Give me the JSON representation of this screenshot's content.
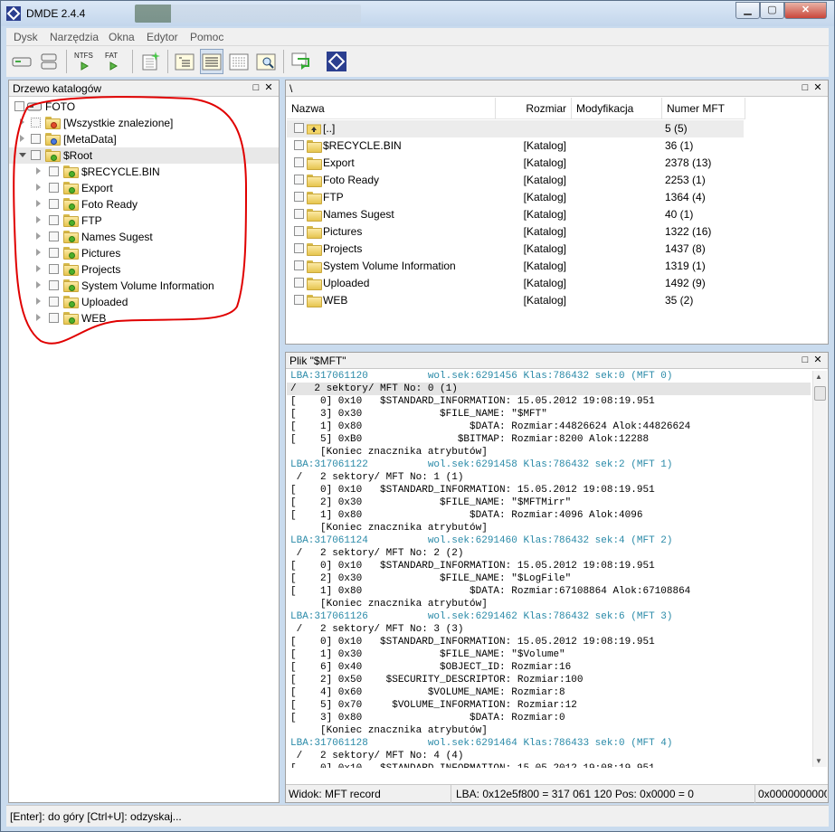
{
  "window": {
    "title": "DMDE 2.4.4"
  },
  "menu": [
    "Dysk",
    "Narzędzia",
    "Okna",
    "Edytor",
    "Pomoc"
  ],
  "toolbar": {
    "ntfs_label": "NTFS",
    "fat_label": "FAT"
  },
  "tree": {
    "title": "Drzewo katalogów",
    "root_label": "FOTO",
    "top_items": [
      "[Wszystkie znalezione]",
      "[MetaData]",
      "$Root"
    ],
    "root_children": [
      "$RECYCLE.BIN",
      "Export",
      "Foto Ready",
      "FTP",
      "Names Sugest",
      "Pictures",
      "Projects",
      "System Volume Information",
      "Uploaded",
      "WEB"
    ]
  },
  "list": {
    "path": "\\",
    "columns": {
      "name": "Nazwa",
      "size": "Rozmiar",
      "modified": "Modyfikacja",
      "mft": "Numer MFT"
    },
    "rows": [
      {
        "name": "[..]",
        "size": "",
        "mft": "5 (5)"
      },
      {
        "name": "$RECYCLE.BIN",
        "size": "[Katalog]",
        "mft": "36 (1)"
      },
      {
        "name": "Export",
        "size": "[Katalog]",
        "mft": "2378 (13)"
      },
      {
        "name": "Foto Ready",
        "size": "[Katalog]",
        "mft": "2253 (1)"
      },
      {
        "name": "FTP",
        "size": "[Katalog]",
        "mft": "1364 (4)"
      },
      {
        "name": "Names Sugest",
        "size": "[Katalog]",
        "mft": "40 (1)"
      },
      {
        "name": "Pictures",
        "size": "[Katalog]",
        "mft": "1322 (16)"
      },
      {
        "name": "Projects",
        "size": "[Katalog]",
        "mft": "1437 (8)"
      },
      {
        "name": "System Volume Information",
        "size": "[Katalog]",
        "mft": "1319 (1)"
      },
      {
        "name": "Uploaded",
        "size": "[Katalog]",
        "mft": "1492 (9)"
      },
      {
        "name": "WEB",
        "size": "[Katalog]",
        "mft": "35 (2)"
      }
    ]
  },
  "mft_pane": {
    "title": "Plik \"$MFT\"",
    "lines": [
      {
        "t": "LBA:317061120          wol.sek:6291456 Klas:786432 sek:0 (MFT 0)",
        "k": "lba"
      },
      {
        "t": "/   2 sektory/ MFT No: 0 (1)",
        "k": "hl"
      },
      {
        "t": "[    0] 0x10   $STANDARD_INFORMATION: 15.05.2012 19:08:19.951",
        "k": ""
      },
      {
        "t": "[    3] 0x30             $FILE_NAME: \"$MFT\"",
        "k": ""
      },
      {
        "t": "[    1] 0x80                  $DATA: Rozmiar:44826624 Alok:44826624",
        "k": ""
      },
      {
        "t": "[    5] 0xB0                $BITMAP: Rozmiar:8200 Alok:12288",
        "k": ""
      },
      {
        "t": "     [Koniec znacznika atrybutów]",
        "k": ""
      },
      {
        "t": "LBA:317061122          wol.sek:6291458 Klas:786432 sek:2 (MFT 1)",
        "k": "lba"
      },
      {
        "t": " /   2 sektory/ MFT No: 1 (1)",
        "k": ""
      },
      {
        "t": "[    0] 0x10   $STANDARD_INFORMATION: 15.05.2012 19:08:19.951",
        "k": ""
      },
      {
        "t": "[    2] 0x30             $FILE_NAME: \"$MFTMirr\"",
        "k": ""
      },
      {
        "t": "[    1] 0x80                  $DATA: Rozmiar:4096 Alok:4096",
        "k": ""
      },
      {
        "t": "     [Koniec znacznika atrybutów]",
        "k": ""
      },
      {
        "t": "LBA:317061124          wol.sek:6291460 Klas:786432 sek:4 (MFT 2)",
        "k": "lba"
      },
      {
        "t": " /   2 sektory/ MFT No: 2 (2)",
        "k": ""
      },
      {
        "t": "[    0] 0x10   $STANDARD_INFORMATION: 15.05.2012 19:08:19.951",
        "k": ""
      },
      {
        "t": "[    2] 0x30             $FILE_NAME: \"$LogFile\"",
        "k": ""
      },
      {
        "t": "[    1] 0x80                  $DATA: Rozmiar:67108864 Alok:67108864",
        "k": ""
      },
      {
        "t": "     [Koniec znacznika atrybutów]",
        "k": ""
      },
      {
        "t": "LBA:317061126          wol.sek:6291462 Klas:786432 sek:6 (MFT 3)",
        "k": "lba"
      },
      {
        "t": " /   2 sektory/ MFT No: 3 (3)",
        "k": ""
      },
      {
        "t": "[    0] 0x10   $STANDARD_INFORMATION: 15.05.2012 19:08:19.951",
        "k": ""
      },
      {
        "t": "[    1] 0x30             $FILE_NAME: \"$Volume\"",
        "k": ""
      },
      {
        "t": "[    6] 0x40             $OBJECT_ID: Rozmiar:16",
        "k": ""
      },
      {
        "t": "[    2] 0x50    $SECURITY_DESCRIPTOR: Rozmiar:100",
        "k": ""
      },
      {
        "t": "[    4] 0x60           $VOLUME_NAME: Rozmiar:8",
        "k": ""
      },
      {
        "t": "[    5] 0x70     $VOLUME_INFORMATION: Rozmiar:12",
        "k": ""
      },
      {
        "t": "[    3] 0x80                  $DATA: Rozmiar:0",
        "k": ""
      },
      {
        "t": "     [Koniec znacznika atrybutów]",
        "k": ""
      },
      {
        "t": "LBA:317061128          wol.sek:6291464 Klas:786433 sek:0 (MFT 4)",
        "k": "lba"
      },
      {
        "t": " /   2 sektory/ MFT No: 4 (4)",
        "k": ""
      },
      {
        "t": "[    0] 0x10   $STANDARD_INFORMATION: 15.05.2012 19:08:19.951",
        "k": ""
      }
    ],
    "status_view": "Widok: MFT record",
    "status_lba": "LBA: 0x12e5f800 = 317 061 120  Pos: 0x0000 = 0",
    "status_hex": "0x0000000000"
  },
  "status": {
    "hint": "[Enter]: do góry  [Ctrl+U]: odzyskaj..."
  },
  "colors": {
    "annotation": "#e00000",
    "lba_text": "#2a8aa8"
  }
}
